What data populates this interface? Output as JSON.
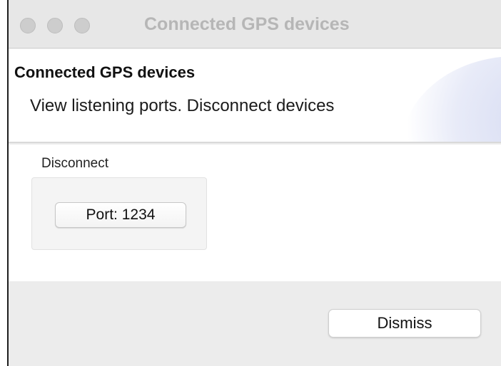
{
  "window": {
    "title": "Connected GPS devices"
  },
  "header": {
    "title": "Connected GPS devices",
    "subtitle": "View listening ports. Disconnect devices"
  },
  "disconnect_group": {
    "label": "Disconnect",
    "buttons": [
      {
        "label": "Port: 1234"
      }
    ]
  },
  "footer": {
    "dismiss_label": "Dismiss"
  },
  "colors": {
    "window_bg": "#ececec",
    "header_bg": "#ffffff",
    "title_inactive": "#b6b6b6",
    "traffic_light_inactive": "#cdcdcd"
  }
}
